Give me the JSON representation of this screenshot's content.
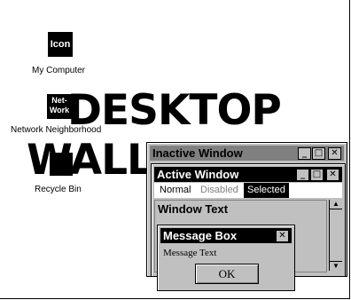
{
  "desktop": {
    "wallpaper_line1": "DESKTOP",
    "wallpaper_line2": "WALL",
    "icons": [
      {
        "icon_text": "Icon",
        "label": "My Computer"
      },
      {
        "icon_text_line1": "Net-",
        "icon_text_line2": "Work",
        "label": "Network Neighborhood"
      },
      {
        "label": "Recycle Bin"
      }
    ]
  },
  "inactive_window": {
    "title": "Inactive Window",
    "buttons": [
      "_",
      "□",
      "✕"
    ]
  },
  "active_window": {
    "title": "Active Window",
    "buttons": [
      "_",
      "□",
      "✕"
    ],
    "menu": {
      "normal": "Normal",
      "disabled": "Disabled",
      "selected": "Selected"
    },
    "window_text": "Window Text",
    "scroll_up": "▲",
    "scroll_down": "▼"
  },
  "message_box": {
    "title": "Message Box",
    "close": "✕",
    "text": "Message Text",
    "ok": "OK"
  },
  "colors": {
    "desktop": "#ffffff",
    "face": "#c0c0c0",
    "active_title": "#000000",
    "inactive_title": "#808080"
  }
}
